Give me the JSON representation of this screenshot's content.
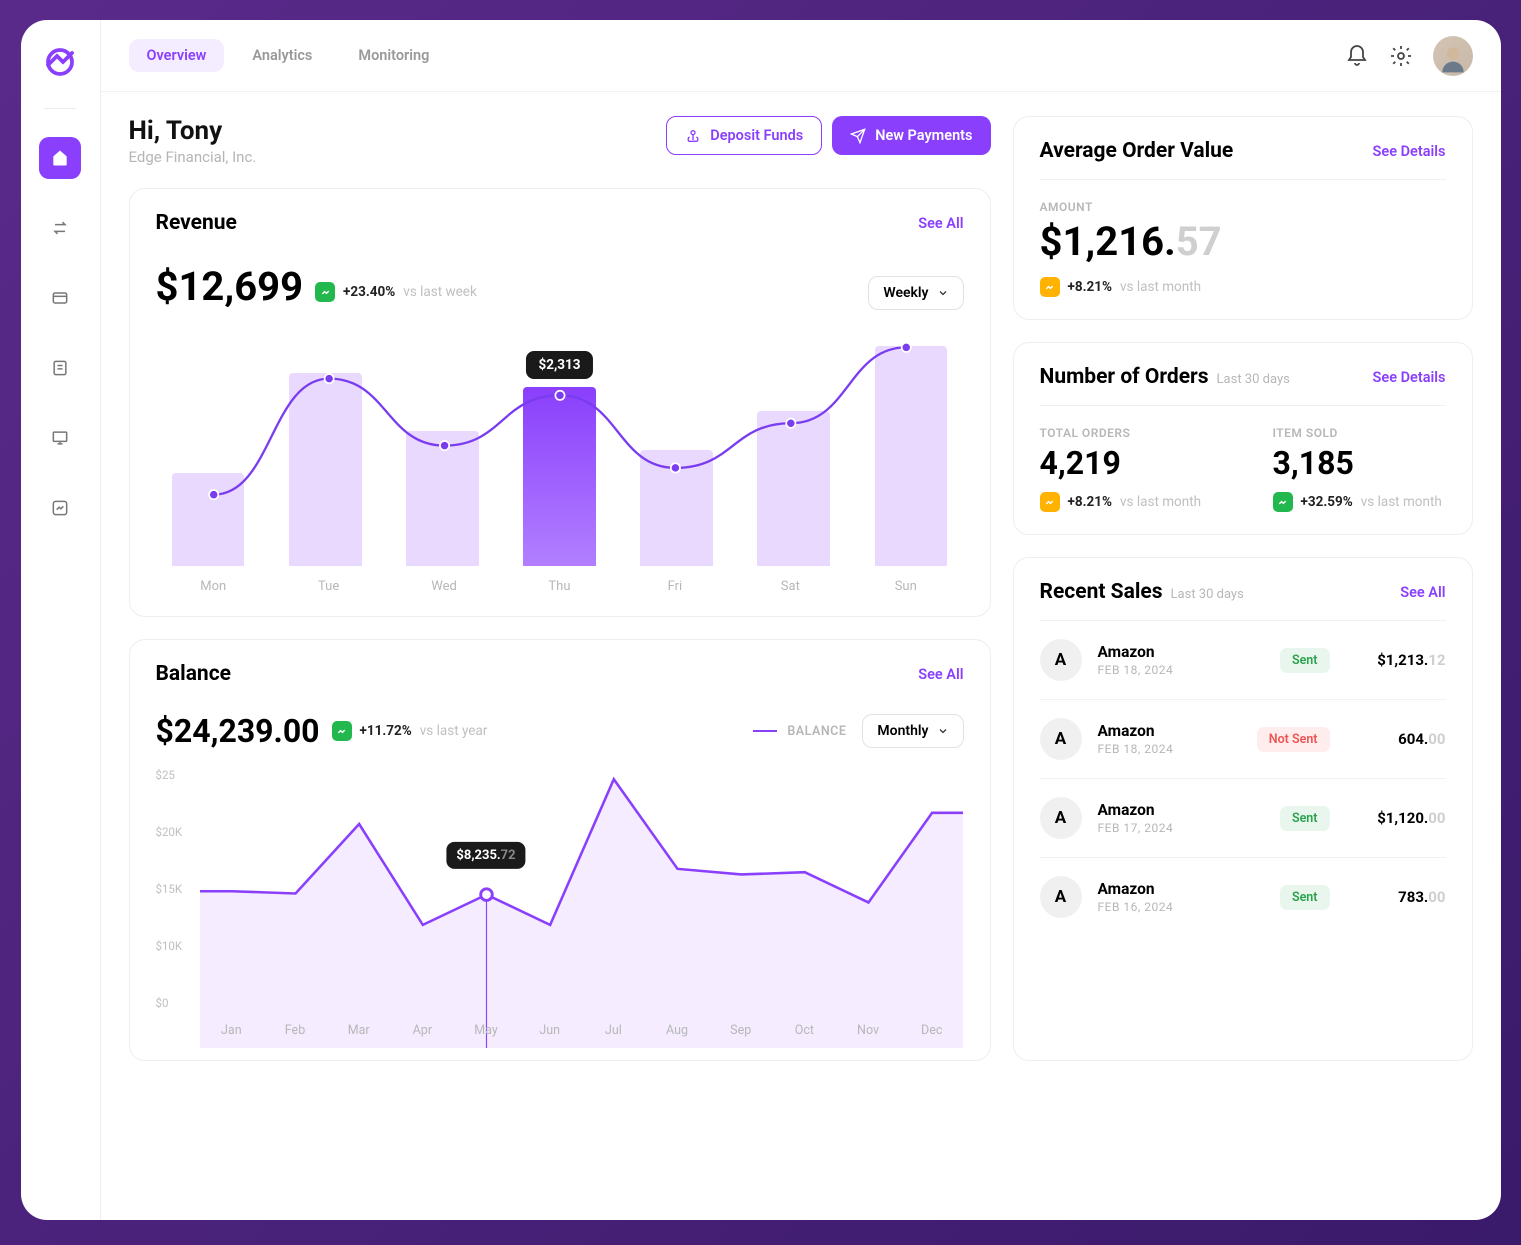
{
  "tabs": [
    "Overview",
    "Analytics",
    "Monitoring"
  ],
  "greeting": {
    "title": "Hi, Tony",
    "subtitle": "Edge Financial, Inc."
  },
  "actions": {
    "deposit": "Deposit Funds",
    "new_payments": "New Payments"
  },
  "revenue": {
    "title": "Revenue",
    "see_all": "See All",
    "value": "$12,699",
    "delta": "+23.40%",
    "delta_sub": "vs last week",
    "period": "Weekly",
    "tooltip": "$2,313"
  },
  "balance": {
    "title": "Balance",
    "see_all": "See All",
    "value": "$24,239.00",
    "delta": "+11.72%",
    "delta_sub": "vs last year",
    "legend": "BALANCE",
    "period": "Monthly",
    "tooltip_main": "$8,235.",
    "tooltip_dim": "72",
    "ylabels": [
      "$25",
      "$20K",
      "$15K",
      "$10K",
      "$0"
    ]
  },
  "aov": {
    "title": "Average Order Value",
    "see_details": "See Details",
    "label": "AMOUNT",
    "value_main": "$1,216.",
    "value_dim": "57",
    "delta": "+8.21%",
    "delta_sub": "vs last month"
  },
  "orders": {
    "title": "Number of Orders",
    "sub": "Last 30 days",
    "see_details": "See Details",
    "total_label": "TOTAL ORDERS",
    "total_value": "4,219",
    "total_delta": "+8.21%",
    "total_delta_sub": "vs last month",
    "sold_label": "ITEM SOLD",
    "sold_value": "3,185",
    "sold_delta": "+32.59%",
    "sold_delta_sub": "vs last month"
  },
  "sales": {
    "title": "Recent Sales",
    "sub": "Last 30 days",
    "see_all": "See All",
    "rows": [
      {
        "initial": "A",
        "name": "Amazon",
        "date": "FEB 18, 2024",
        "status": "Sent",
        "status_cls": "sent",
        "amount_main": "$1,213.",
        "amount_dim": "12"
      },
      {
        "initial": "A",
        "name": "Amazon",
        "date": "FEB 18, 2024",
        "status": "Not Sent",
        "status_cls": "notsent",
        "amount_main": "604.",
        "amount_dim": "00"
      },
      {
        "initial": "A",
        "name": "Amazon",
        "date": "FEB 17, 2024",
        "status": "Sent",
        "status_cls": "sent",
        "amount_main": "$1,120.",
        "amount_dim": "00"
      },
      {
        "initial": "A",
        "name": "Amazon",
        "date": "FEB 16, 2024",
        "status": "Sent",
        "status_cls": "sent",
        "amount_main": "783.",
        "amount_dim": "00"
      }
    ]
  },
  "chart_data": [
    {
      "type": "bar+line",
      "title": "Revenue",
      "categories": [
        "Mon",
        "Tue",
        "Wed",
        "Thu",
        "Fri",
        "Sat",
        "Sun"
      ],
      "values": [
        1200,
        2500,
        1750,
        2313,
        1500,
        2000,
        2850
      ],
      "line_values": [
        1200,
        2500,
        1750,
        2313,
        1500,
        2000,
        2850
      ],
      "highlight_index": 3,
      "highlight_value": 2313,
      "ylim": [
        0,
        3000
      ]
    },
    {
      "type": "area",
      "title": "Balance",
      "categories": [
        "Jan",
        "Feb",
        "Mar",
        "Apr",
        "May",
        "Jun",
        "Jul",
        "Aug",
        "Sep",
        "Oct",
        "Nov",
        "Dec"
      ],
      "values": [
        14000,
        13800,
        20000,
        11000,
        13700,
        11000,
        24000,
        16000,
        15500,
        15700,
        13000,
        21000
      ],
      "tooltip_index": 4,
      "tooltip_value": 8235.72,
      "ylabel": "Balance ($)",
      "ylim": [
        0,
        25000
      ]
    }
  ]
}
